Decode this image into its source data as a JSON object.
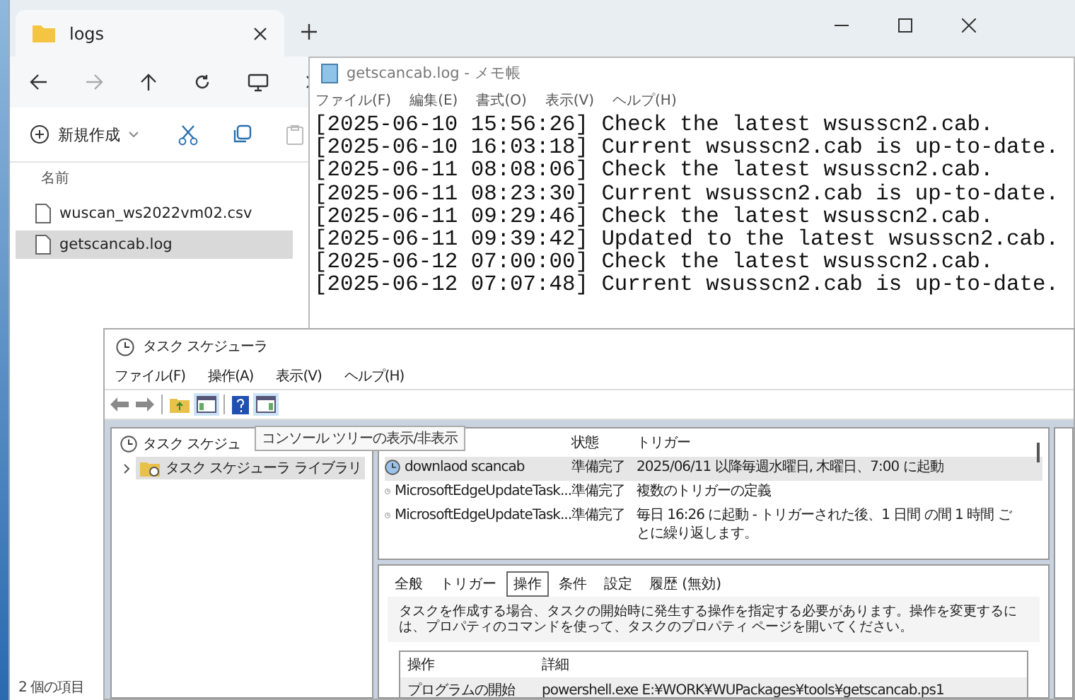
{
  "explorer": {
    "tab_title": "logs",
    "new_label": "新規作成",
    "column_header": "名前",
    "files": [
      {
        "name": "wuscan_ws2022vm02.csv",
        "selected": false
      },
      {
        "name": "getscancab.log",
        "selected": true
      }
    ],
    "status": "2 個の項目"
  },
  "notepad": {
    "title": "getscancab.log - メモ帳",
    "menu": [
      "ファイル(F)",
      "編集(E)",
      "書式(O)",
      "表示(V)",
      "ヘルプ(H)"
    ],
    "lines": [
      "[2025-06-10 15:56:26] Check the latest wsusscn2.cab.",
      "[2025-06-10 16:03:18] Current wsusscn2.cab is up-to-date.",
      "[2025-06-11 08:08:06] Check the latest wsusscn2.cab.",
      "[2025-06-11 08:23:30] Current wsusscn2.cab is up-to-date.",
      "[2025-06-11 09:29:46] Check the latest wsusscn2.cab.",
      "[2025-06-11 09:39:42] Updated to the latest wsusscn2.cab.",
      "[2025-06-12 07:00:00] Check the latest wsusscn2.cab.",
      "[2025-06-12 07:07:48] Current wsusscn2.cab is up-to-date."
    ]
  },
  "scheduler": {
    "title": "タスク スケジューラ",
    "menu": [
      "ファイル(F)",
      "操作(A)",
      "表示(V)",
      "ヘルプ(H)"
    ],
    "tree": [
      {
        "label": "タスク スケジュ",
        "selected": false,
        "children": [
          {
            "label": "タスク スケジューラ ライブラリ",
            "selected": true,
            "expanded": false
          }
        ]
      }
    ],
    "tooltip": "コンソール ツリーの表示/非表示",
    "task_columns": [
      "状態",
      "トリガー"
    ],
    "tasks": [
      {
        "name": "downlaod scancab",
        "status": "準備完了",
        "trigger": "2025/06/11 以降毎週水曜日, 木曜日、7:00 に起動",
        "selected": true
      },
      {
        "name": "MicrosoftEdgeUpdateTask...",
        "status": "準備完了",
        "trigger": "複数のトリガーの定義",
        "selected": false
      },
      {
        "name": "MicrosoftEdgeUpdateTask...",
        "status": "準備完了",
        "trigger": "毎日 16:26 に起動 - トリガーされた後、1 日間 の間 1 時間 ごとに繰り返します。",
        "selected": false
      }
    ],
    "tabs": [
      {
        "label": "全般",
        "selected": false
      },
      {
        "label": "トリガー",
        "selected": false
      },
      {
        "label": "操作",
        "selected": true
      },
      {
        "label": "条件",
        "selected": false
      },
      {
        "label": "設定",
        "selected": false
      },
      {
        "label": "履歴 (無効)",
        "selected": false
      }
    ],
    "description": "タスクを作成する場合、タスクの開始時に発生する操作を指定する必要があります。操作を変更するには、プロパティのコマンドを使って、タスクのプロパティ ページを開いてください。",
    "action_columns": [
      "操作",
      "詳細"
    ],
    "actions": [
      {
        "action": "プログラムの開始",
        "detail": "powershell.exe E:¥WORK¥WUPackages¥tools¥getscancab.ps1"
      }
    ]
  }
}
